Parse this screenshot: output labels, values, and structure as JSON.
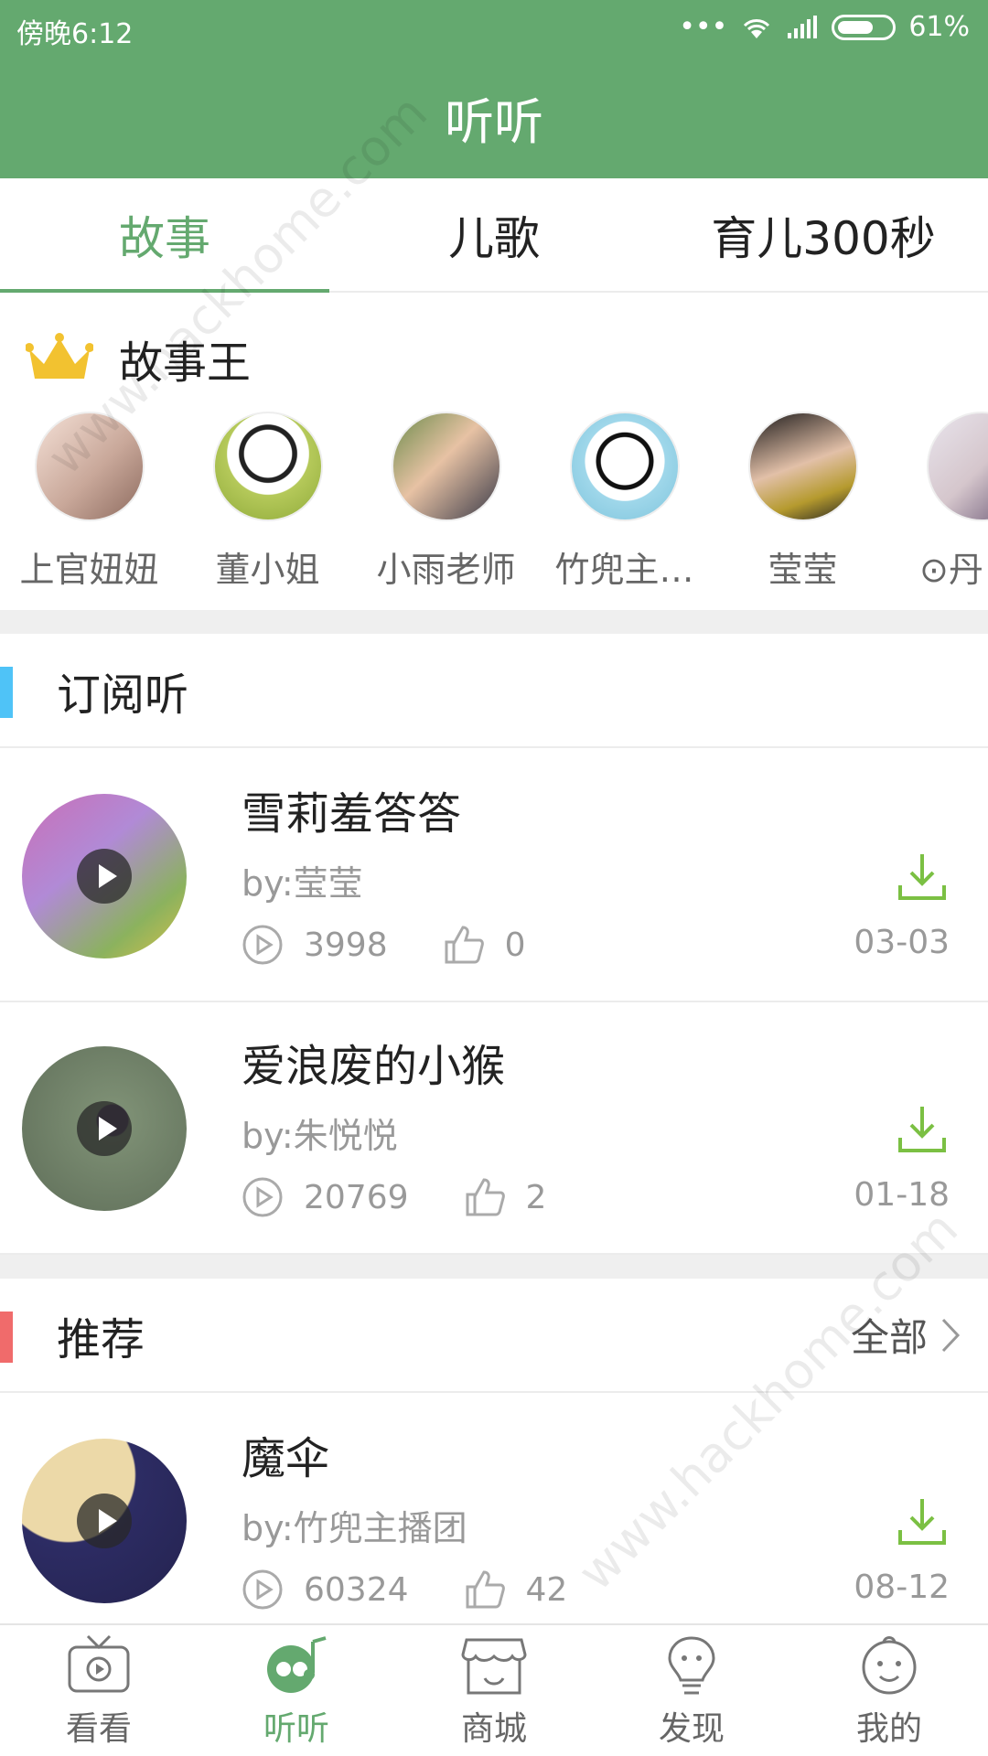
{
  "status_bar": {
    "time": "傍晚6:12",
    "dots": "•••",
    "battery": "61%"
  },
  "app_bar": {
    "title": "听听"
  },
  "tabs": [
    {
      "label": "故事",
      "active": true
    },
    {
      "label": "儿歌",
      "active": false
    },
    {
      "label": "育儿300秒",
      "active": false
    }
  ],
  "story_king": {
    "title": "故事王",
    "hosts": [
      {
        "name": "上官妞妞"
      },
      {
        "name": "董小姐"
      },
      {
        "name": "小雨老师"
      },
      {
        "name": "竹兜主…"
      },
      {
        "name": "莹莹"
      },
      {
        "name": "⊙丹"
      }
    ]
  },
  "subscribed": {
    "title": "订阅听",
    "accent_color": "#4fc3f7",
    "items": [
      {
        "title": "雪莉羞答答",
        "author": "by:莹莹",
        "plays": "3998",
        "likes": "0",
        "date": "03-03"
      },
      {
        "title": "爱浪废的小猴",
        "author": "by:朱悦悦",
        "plays": "20769",
        "likes": "2",
        "date": "01-18"
      }
    ]
  },
  "recommend": {
    "title": "推荐",
    "all_label": "全部",
    "accent_color": "#f06b6b",
    "items": [
      {
        "title": "魔伞",
        "author": "by:竹兜主播团",
        "plays": "60324",
        "likes": "42",
        "date": "08-12"
      }
    ]
  },
  "bottom_nav": [
    {
      "label": "看看",
      "icon": "tv-icon",
      "active": false
    },
    {
      "label": "听听",
      "icon": "headphone-icon",
      "active": true
    },
    {
      "label": "商城",
      "icon": "store-icon",
      "active": false
    },
    {
      "label": "发现",
      "icon": "bulb-icon",
      "active": false
    },
    {
      "label": "我的",
      "icon": "baby-face-icon",
      "active": false
    }
  ],
  "colors": {
    "brand": "#64a96f",
    "download": "#7bc043"
  },
  "watermark": "www.hackhome.com"
}
